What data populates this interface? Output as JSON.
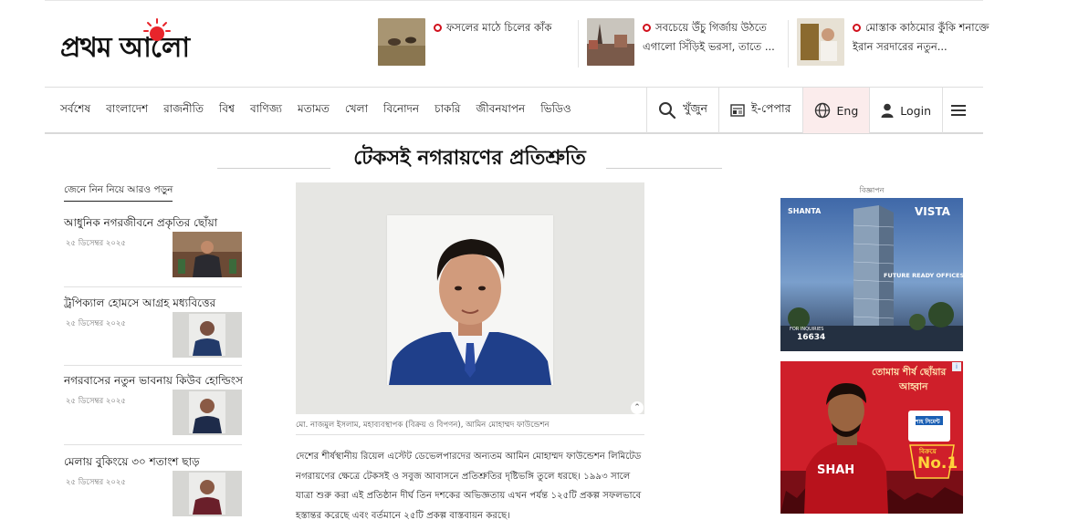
{
  "masthead": {
    "logo_text": "প্রথম আলো",
    "teasers": [
      {
        "text": "ফসলের মাঠে চিলের কাঁক"
      },
      {
        "text": "সবচেয়ে উঁচু গির্জায় উঠতে এগালো সিঁড়িই ভরসা, তাতে ..."
      },
      {
        "text": "মোস্তাক কাঠমোর কুঁকি শনাক্তে ইরান সরদারের নতুন..."
      }
    ]
  },
  "nav": {
    "items": [
      "সর্বশেষ",
      "বাংলাদেশ",
      "রাজনীতি",
      "বিশ্ব",
      "বাণিজ্য",
      "মতামত",
      "খেলা",
      "বিনোদন",
      "চাকরি",
      "জীবনযাপন",
      "ভিডিও"
    ],
    "search_label": "খুঁজুন",
    "epaper_label": "ই-পেপার",
    "lang_label": "Eng",
    "login_label": "Login",
    "icons": {
      "search": "search-icon",
      "epaper": "epaper-icon",
      "lang": "globe-icon",
      "login": "user-icon",
      "menu": "hamburger-menu-icon"
    }
  },
  "headline": "টেকসই নগরায়ণের প্রতিশ্রুতি",
  "sidebar": {
    "heading": "জেনে নিন নিয়ে আরও পড়ুন",
    "items": [
      {
        "title": "আধুনিক নগরজীবনে প্রকৃতির ছোঁয়া",
        "date": "২৫ ডিসেম্বর ২০২৫"
      },
      {
        "title": "ট্রপিক্যাল হোমসে আগ্রহ মধ্যবিত্তের",
        "date": "২৫ ডিসেম্বর ২০২৫"
      },
      {
        "title": "নগরবাসের নতুন ভাবনায় কিউব হোল্ডিংস",
        "date": "২৫ ডিসেম্বর ২০২৫"
      },
      {
        "title": "মেলায় বুকিংয়ে ৩০ শতাংশ ছাড়",
        "date": "২৫ ডিসেম্বর ২০২৫"
      }
    ]
  },
  "article": {
    "caption": "মো. নাজমুল ইসলাম, মহাব্যবস্থাপক (বিক্রয় ও বিপণন), আমিন মোহাম্মদ ফাউন্ডেশন",
    "body": "দেশের শীর্ষস্থানীয় রিয়েল এস্টেট ডেভেলপারদের অন্যতম আমিন মোহাম্মদ ফাউন্ডেশন লিমিটেড নগরায়ণের ক্ষেত্রে টেকসই ও সবুজ আবাসনে প্রতিশ্রুতির দৃষ্টিভঙ্গি তুলে ধরছে। ১৯৯৩ সালে যাত্রা শুরু করা এই প্রতিষ্ঠান দীর্ঘ তিন দশকের অভিজ্ঞতায় এখন পর্যন্ত ১২৫টি প্রকল্প সফলভাবে হস্তান্তর করেছে এবং বর্তমানে ২৫টি প্রকল্প বাস্তবায়ন করছে।"
  },
  "ads": {
    "label": "বিজ্ঞাপন",
    "ad1": {
      "brand_left": "SHANTA",
      "brand_right": "VISTA",
      "tagline": "FUTURE READY OFFICES",
      "enquiry": "FOR INQUIRIES",
      "phone": "16634"
    },
    "ad2": {
      "headline_line1": "তোমায় শীর্ষ ছোঁয়ার",
      "headline_line2": "আহ্বান",
      "brand": "শাহ সিমেন্ট",
      "badge_top": "বিক্রয়ে",
      "badge": "No.1",
      "jersey": "SHAH"
    }
  }
}
